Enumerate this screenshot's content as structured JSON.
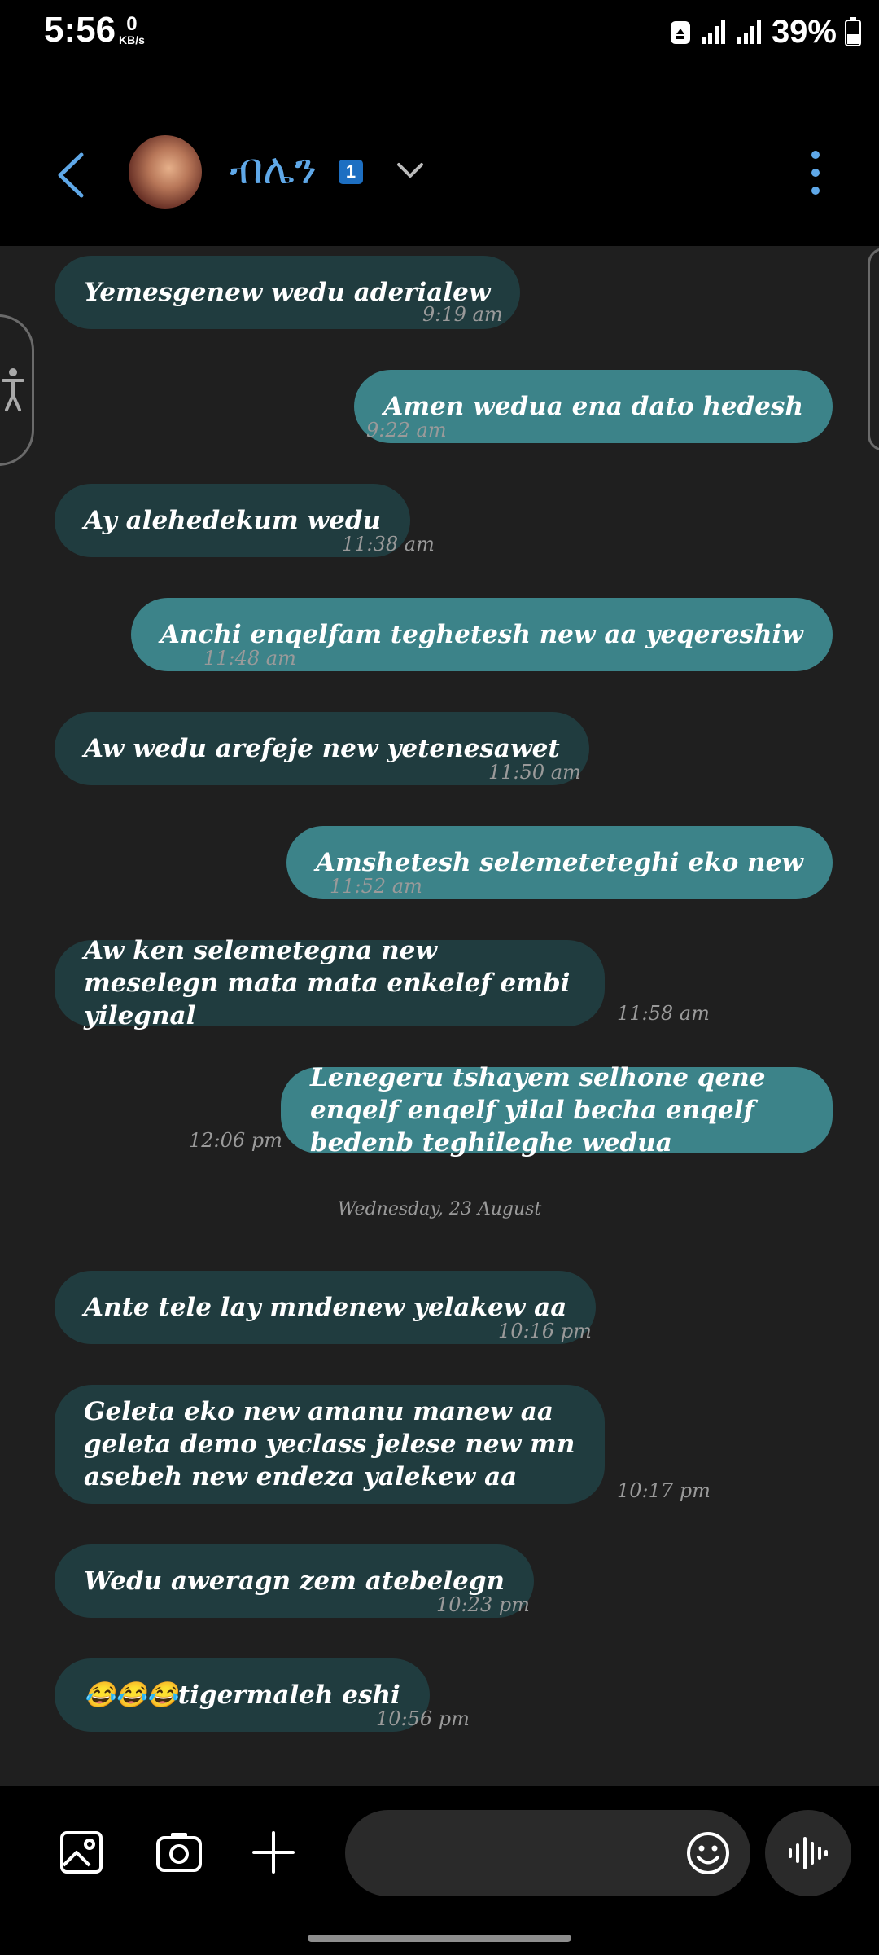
{
  "status_bar": {
    "time": "5:56",
    "net_speed_value": "0",
    "net_speed_unit": "KB/s",
    "battery_percent": "39%",
    "icons": [
      "recycle-icon",
      "signal-icon",
      "signal-icon",
      "battery-icon"
    ]
  },
  "header": {
    "contact_name": "ብሌን",
    "badge": "1",
    "icons": [
      "back-arrow-icon",
      "avatar",
      "chevron-down-icon",
      "more-vertical-icon"
    ]
  },
  "messages": [
    {
      "dir": "in",
      "text": "Yemesgenew wedu aderialew",
      "time": "9:19 am"
    },
    {
      "dir": "out",
      "text": "Amen wedua ena dato hedesh",
      "time": "9:22 am"
    },
    {
      "dir": "in",
      "text": "Ay alehedekum wedu",
      "time": "11:38 am"
    },
    {
      "dir": "out",
      "text": "Anchi enqelfam teghetesh new aa yeqereshiw",
      "time": "11:48 am"
    },
    {
      "dir": "in",
      "text": "Aw wedu arefeje new yetenesawet",
      "time": "11:50 am"
    },
    {
      "dir": "out",
      "text": "Amshetesh selemeteteghi eko new",
      "time": "11:52 am"
    },
    {
      "dir": "in",
      "text": "Aw ken selemetegna new meselegn mata mata enkelef embi yilegnal",
      "time": "11:58 am"
    },
    {
      "dir": "out",
      "text": "Lenegeru tshayem selhone qene enqelf enqelf yilal becha enqelf bedenb teghileghe wedua",
      "time": "12:06 pm"
    },
    {
      "dir": "in",
      "text": "Ante tele lay mndenew yelakew aa",
      "time": "10:16 pm"
    },
    {
      "dir": "in",
      "text": "Geleta eko new amanu manew aa geleta demo yeclass jelese new mn asebeh new endeza yalekew aa",
      "time": "10:17 pm"
    },
    {
      "dir": "in",
      "text": "Wedu aweragn zem atebelegn",
      "time": "10:23 pm"
    },
    {
      "dir": "in",
      "text": "😂😂😂tigermaleh eshi",
      "time": "10:56 pm"
    }
  ],
  "date_separator": "Wednesday, 23 August",
  "composer": {
    "icons": [
      "gallery-icon",
      "camera-icon",
      "plus-icon",
      "emoji-icon",
      "voice-wave-icon"
    ]
  }
}
